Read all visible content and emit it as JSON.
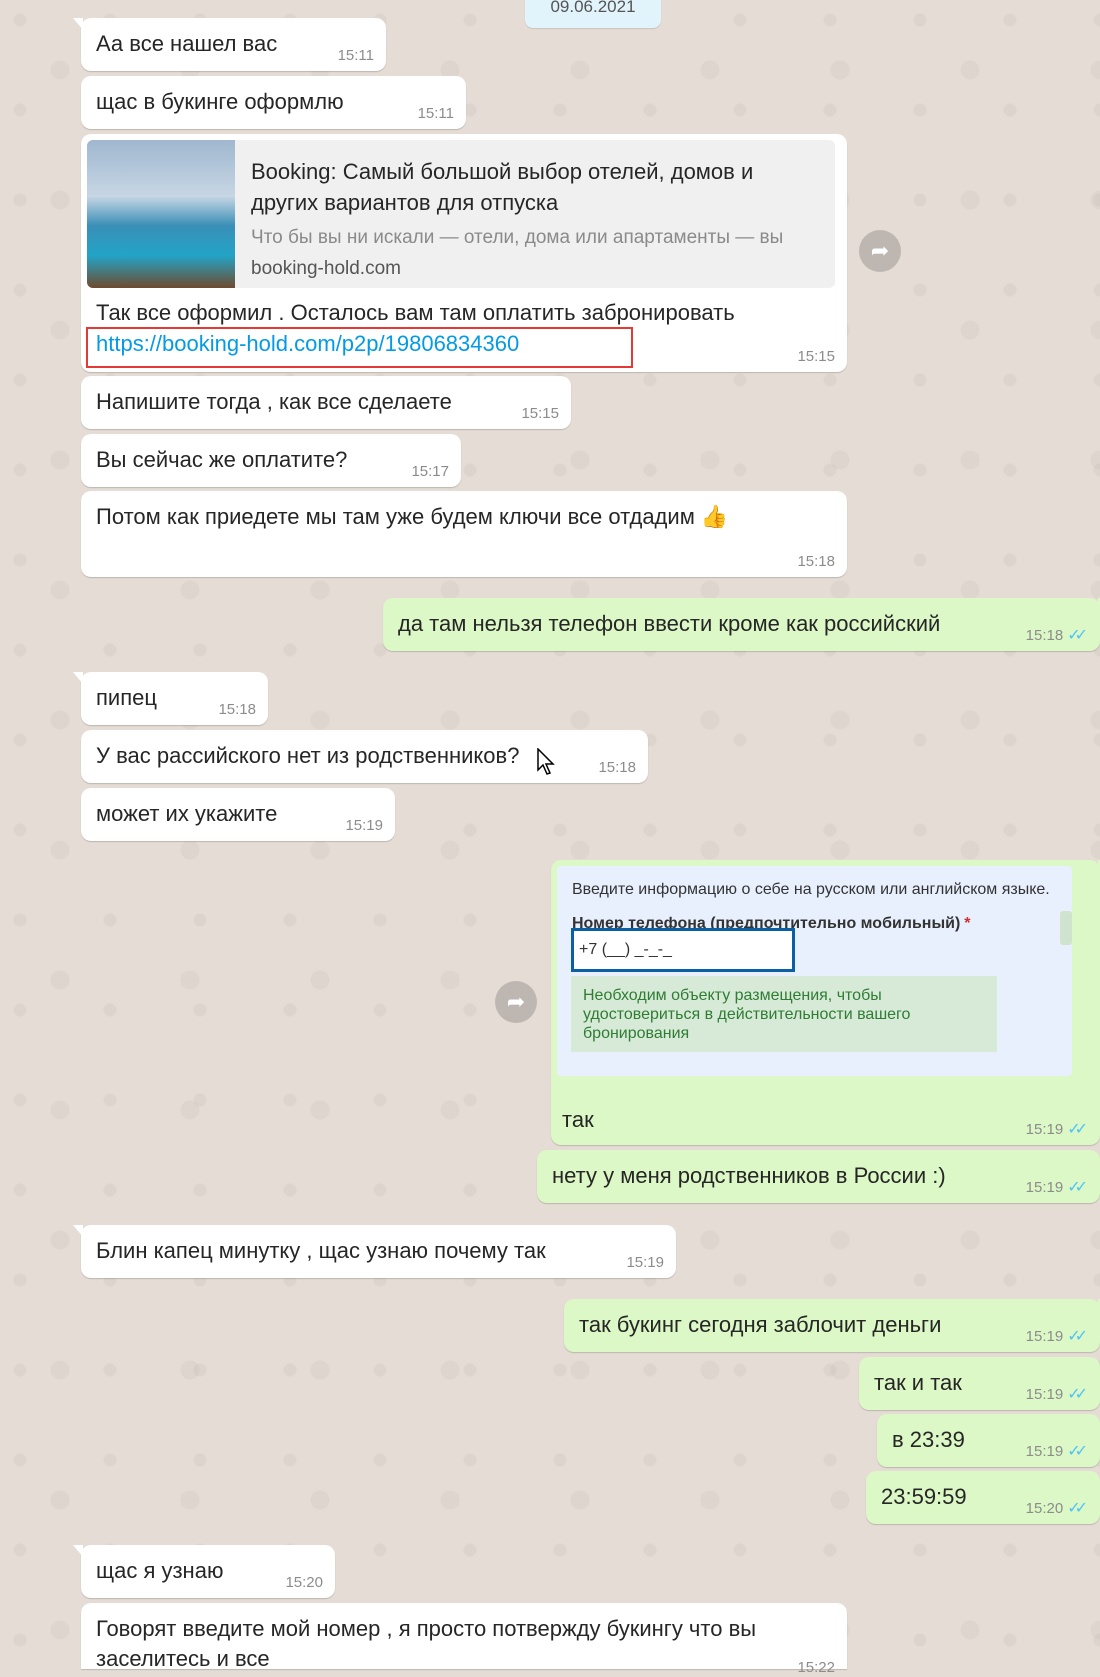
{
  "date_divider": "09.06.2021",
  "messages": [
    {
      "text": "Аа все нашел вас",
      "time": "15:11"
    },
    {
      "text": "щас в букинге оформлю",
      "time": "15:11"
    },
    {
      "preview": {
        "title": "Booking: Самый большой выбор отелей, домов и других вариантов для отпуска",
        "description": "Что бы вы ни искали — отели, дома или апартаменты — вы",
        "domain": "booking-hold.com"
      },
      "text": "Так все оформил . Осталось вам там оплатить забронировать",
      "link": "https://booking-hold.com/p2p/19806834360",
      "time": "15:15"
    },
    {
      "text": "Напишите тогда , как все сделаете",
      "time": "15:15"
    },
    {
      "text": "Вы сейчас же оплатите?",
      "time": "15:17"
    },
    {
      "text": "Потом как приедете мы там уже будем ключи все отдадим 👍",
      "time": "15:18"
    },
    {
      "text": "да там нельзя телефон ввести кроме как российский",
      "time": "15:18"
    },
    {
      "text": "пипец",
      "time": "15:18"
    },
    {
      "text": "У вас рассийского нет из родственников?",
      "time": "15:18"
    },
    {
      "text": "может их укажите",
      "time": "15:19"
    },
    {
      "form": {
        "hint": "Введите информацию о себе на русском или английском языке.",
        "label": "Номер телефона (предпочтительно мобильный)",
        "required_mark": "*",
        "input_value": "+7 (__) _-_-_",
        "note": "Необходим объекту размещения, чтобы удостовериться в действительности вашего бронирования"
      },
      "text": "так",
      "time": "15:19"
    },
    {
      "text": "нету у меня родственников в России :)",
      "time": "15:19"
    },
    {
      "text": "Блин капец минутку , щас узнаю почему так",
      "time": "15:19"
    },
    {
      "text": "так букинг сегодня заблочит деньги",
      "time": "15:19"
    },
    {
      "text": "так и так",
      "time": "15:19"
    },
    {
      "text": "в 23:39",
      "time": "15:19"
    },
    {
      "text": "23:59:59",
      "time": "15:20"
    },
    {
      "text": "щас я узнаю",
      "time": "15:20"
    },
    {
      "text": "Говорят введите мой номер , я просто потвержду букингу что вы\nзаселитесь и все",
      "time": "15:22"
    }
  ],
  "icons": {
    "forward": "forward-arrow-icon",
    "read_receipt": "double-check-icon",
    "cursor": "mouse-pointer-icon"
  },
  "colors": {
    "incoming_bubble": "#ffffff",
    "outgoing_bubble": "#dcf8c6",
    "link": "#039be5",
    "read_ticks": "#4fc3f7",
    "highlight_box": "#e53935"
  }
}
